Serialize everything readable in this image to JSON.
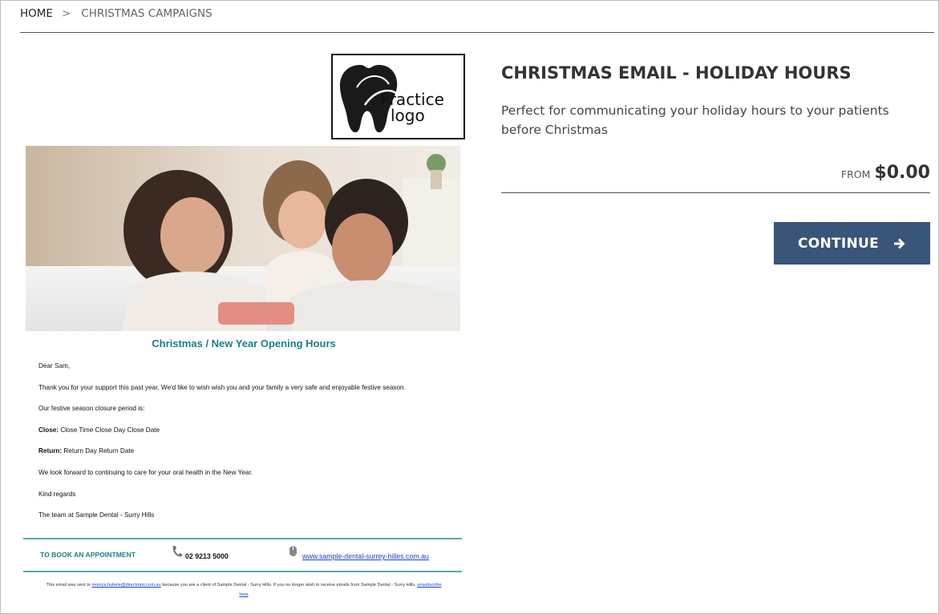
{
  "breadcrumb": {
    "home": "HOME",
    "separator": ">",
    "current": "CHRISTMAS CAMPAIGNS"
  },
  "product": {
    "title": "CHRISTMAS EMAIL - HOLIDAY HOURS",
    "description": "Perfect for communicating your holiday hours to your patients before Christmas",
    "price_prefix": "FROM",
    "price": "$0.00",
    "continue_label": "CONTINUE"
  },
  "preview": {
    "logo_line1": "Practice",
    "logo_line2": "logo",
    "heading": "Christmas / New Year Opening Hours",
    "greeting": "Dear Sam,",
    "line1": "Thank you for your support this past year. We'd like to wish wish you and your family a very safe and enjoyable festive season.",
    "line2": "Our festive season closure period is:",
    "close_label": "Close:",
    "close_value": "Close Time Close Day Close Date",
    "return_label": "Return:",
    "return_value": "Return Day Return Date",
    "line3": "We look forward to continuing to care for your oral health in the New Year.",
    "signoff": "Kind regards",
    "signature": "The team at Sample Dental - Surry Hills",
    "book_label": "TO BOOK AN APPOINTMENT",
    "phone": "02 9213 5000",
    "website": "www.sample-dental-surrey-hilles.com.au",
    "footer_prefix": "This email was sent to",
    "footer_email": "monica.hubele@directmmi.com.au",
    "footer_middle": "because you are a client of Sample Dental - Surry Hills. If you no longer wish to receive emails from Sample Dental - Surry Hills,",
    "footer_unsub_1": "unsubscribe",
    "footer_unsub_2": "here"
  },
  "colors": {
    "button": "#395579",
    "teal": "#1b7f86",
    "link": "#1a3fd8"
  },
  "icons": [
    "chevron-right-icon",
    "arrow-right-icon",
    "phone-icon",
    "mouse-icon",
    "tooth-logo-icon"
  ]
}
